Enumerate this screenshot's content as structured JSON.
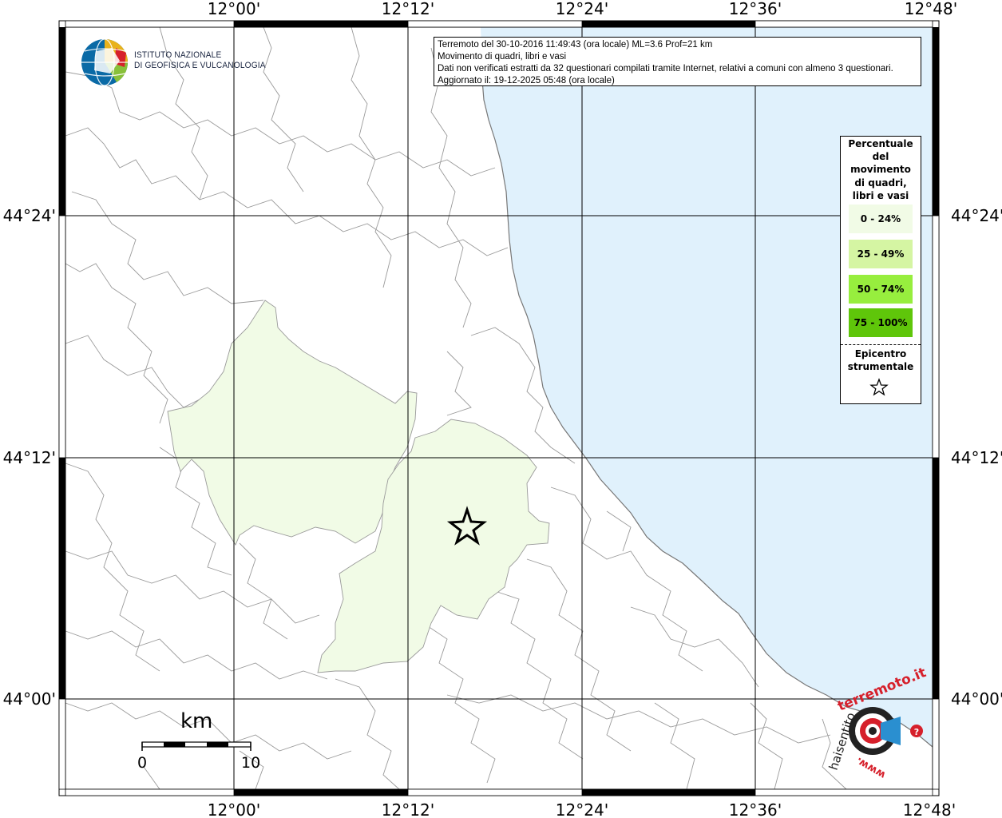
{
  "map": {
    "lon_labels": [
      "12°00'",
      "12°12'",
      "12°24'",
      "12°36'",
      "12°48'"
    ],
    "lat_labels": [
      "44°24'",
      "44°12'",
      "44°00'"
    ],
    "colors": {
      "sea": "#e0f1fc",
      "land": "#ffffff",
      "class_0_24": "#f1fbe6",
      "class_25_49": "#d5f5a3",
      "class_50_74": "#97ee3e",
      "class_75_100": "#5fc60a",
      "borders": "#9a9a9a",
      "grid": "#000000"
    }
  },
  "logo": {
    "line1": "ISTITUTO NAZIONALE",
    "line2": "DI GEOFISICA E VULCANOLOGIA"
  },
  "info": {
    "line1": "Terremoto del 30-10-2016 11:49:43 (ora locale) ML=3.6 Prof=21 km",
    "line2": "Movimento di quadri, libri e vasi",
    "line3": "Dati non verificati estratti da 32 questionari compilati tramite Internet, relativi a comuni con almeno 3 questionari.",
    "line4": "Aggiornato il: 19-12-2025 05:48 (ora locale)"
  },
  "legend": {
    "title_lines": [
      "Percentuale",
      "del",
      "movimento",
      "di quadri,",
      "libri e vasi"
    ],
    "classes": [
      {
        "label": "0 - 24%",
        "color": "#f1fbe6"
      },
      {
        "label": "25 - 49%",
        "color": "#d5f5a3"
      },
      {
        "label": "50 - 74%",
        "color": "#97ee3e"
      },
      {
        "label": "75 - 100%",
        "color": "#5fc60a"
      }
    ],
    "epicenter_line1": "Epicentro",
    "epicenter_line2": "strumentale",
    "epicenter_icon": "star-outline-icon"
  },
  "scale": {
    "unit": "km",
    "min_label": "0",
    "max_label": "10"
  },
  "badge": {
    "text_top": "terremoto.it",
    "text_left": "haisentito",
    "text_bottom": "www.",
    "icon": "megaphone-target-icon"
  }
}
